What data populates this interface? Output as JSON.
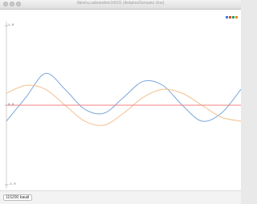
{
  "window": {
    "title": "/dev/cu.usbmodem14101 (Arduino/Genuino Uno)"
  },
  "plot": {
    "y_ticks": [
      {
        "label": "1.0",
        "value": 1.0
      },
      {
        "label": "0.0",
        "value": 0.0
      },
      {
        "label": "-1.0",
        "value": -1.0
      }
    ],
    "colors": {
      "axis": "#cfcfcf",
      "grid": "#eeeeee",
      "zero_line": "#f08080",
      "series_blue": "#7aa6d9",
      "series_orange": "#f3c08e"
    },
    "legend_colors": [
      "#3b7dd8",
      "#e0492f",
      "#2e9e4f",
      "#e58b2a"
    ]
  },
  "chart_data": {
    "type": "line",
    "title": "",
    "xlabel": "",
    "ylabel": "",
    "ylim": [
      -1.0,
      1.0
    ],
    "x": [
      0,
      25,
      50,
      75,
      100,
      125,
      150,
      175,
      200,
      225,
      250,
      275,
      300
    ],
    "series": [
      {
        "values": [
          -0.2,
          0.1,
          0.4,
          0.2,
          -0.05,
          -0.1,
          0.1,
          0.3,
          0.25,
          0.0,
          -0.2,
          -0.1,
          0.2
        ],
        "color": "#7aa6d9"
      },
      {
        "values": [
          0.15,
          0.25,
          0.2,
          0.0,
          -0.2,
          -0.25,
          -0.1,
          0.1,
          0.2,
          0.15,
          0.0,
          -0.15,
          -0.2
        ],
        "color": "#f3c08e"
      },
      {
        "values": [
          0.0,
          0.0,
          0.0,
          0.0,
          0.0,
          0.0,
          0.0,
          0.0,
          0.0,
          0.0,
          0.0,
          0.0,
          0.0
        ],
        "color": "#f08080"
      }
    ]
  },
  "toolbar": {
    "baud_rate": "115200 baud"
  }
}
